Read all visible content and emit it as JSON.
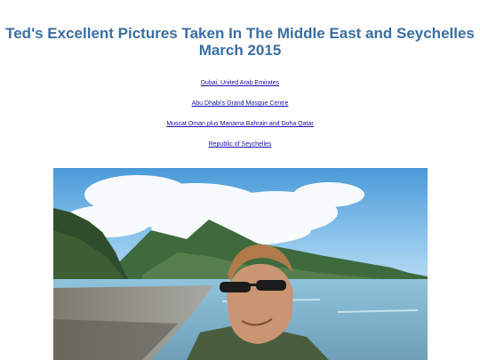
{
  "page": {
    "title_line1": "Ted's Excellent Pictures Taken In The Middle East and Seychelles",
    "title_line2": "March 2015"
  },
  "links": [
    {
      "label": "Dubai, United Arab Emirates"
    },
    {
      "label": "Abu Dhabi's Grand Mosque Centre"
    },
    {
      "label": "Muscat Oman plus Manama Bahrain and Doha Qatar"
    },
    {
      "label": "Republic of Seychelles"
    }
  ],
  "colors": {
    "title": "#3a6ea5",
    "link": "#1a0dab"
  }
}
